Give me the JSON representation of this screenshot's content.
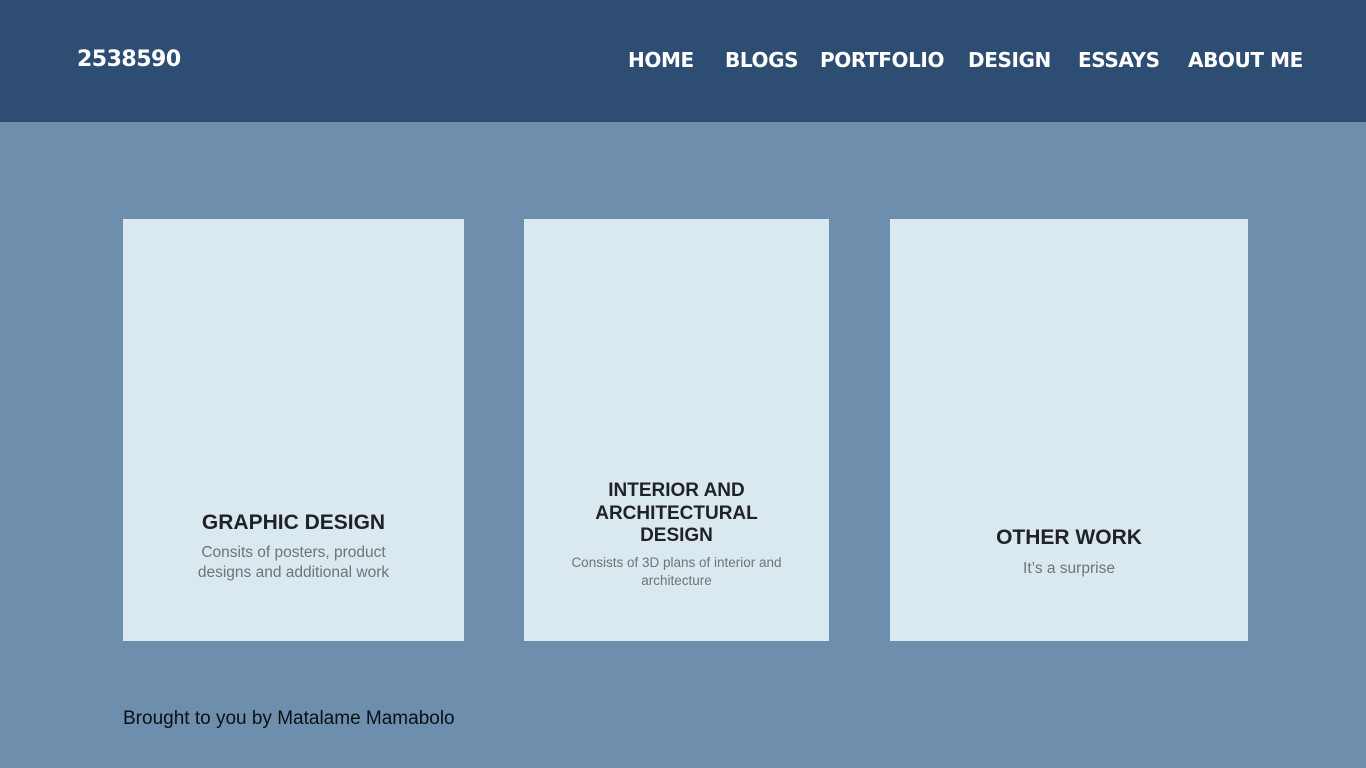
{
  "header": {
    "site_id": "2538590",
    "nav": [
      {
        "label": "HOME"
      },
      {
        "label": "BLOGS"
      },
      {
        "label": "PORTFOLIO"
      },
      {
        "label": "DESIGN"
      },
      {
        "label": "ESSAYS"
      },
      {
        "label": "ABOUT ME"
      }
    ]
  },
  "cards": [
    {
      "title": "GRAPHIC DESIGN",
      "description": "Consits of posters, product designs and additional work"
    },
    {
      "title": "INTERIOR AND ARCHITECTURAL DESIGN",
      "description": "Consists of 3D plans of interior and architecture"
    },
    {
      "title": "OTHER WORK",
      "description": "It’s a surprise"
    }
  ],
  "footer": {
    "credit": "Brought to you by Matalame Mamabolo"
  },
  "colors": {
    "header_bg": "#2e4d73",
    "page_bg": "#6d8fad",
    "card_bg": "#dae8ef",
    "title_text": "#1f2326",
    "desc_text": "#6e7478"
  }
}
